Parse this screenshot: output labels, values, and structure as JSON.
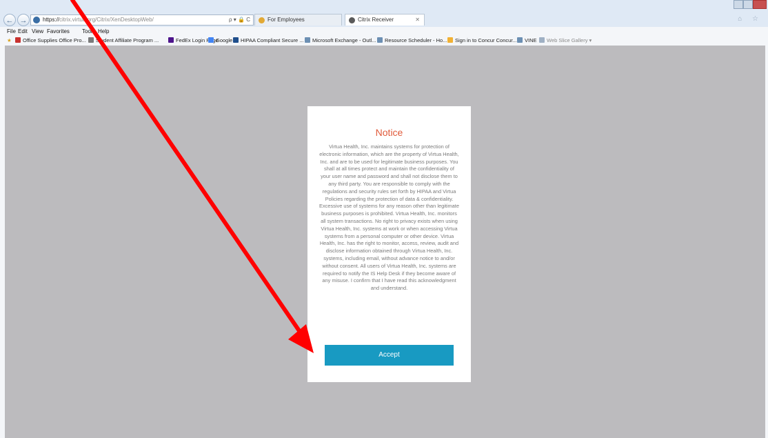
{
  "browser": {
    "address_secure": "https://",
    "address_rest": "citrix.virtua.org/Citrix/XenDesktopWeb/",
    "address_tools": "ρ ▾ 🔒 C",
    "tabs": [
      {
        "label": "For Employees"
      },
      {
        "label": "Citrix Receiver",
        "close": "✕"
      }
    ],
    "nav_back": "←",
    "nav_forward": "→",
    "right_icons": "⌂ ☆"
  },
  "menu": {
    "items": [
      "File",
      "Edit",
      "View",
      "Favorites",
      "Tools",
      "Help"
    ]
  },
  "favorites": {
    "items": [
      {
        "label": "Office Supplies Office Pro..."
      },
      {
        "label": "Student Affiliate Program ..."
      },
      {
        "label": "FedEx Login Page"
      },
      {
        "label": "Google"
      },
      {
        "label": "HIPAA Compliant Secure ..."
      },
      {
        "label": "Microsoft Exchange - Outl..."
      },
      {
        "label": "Resource Scheduler - Ho..."
      },
      {
        "label": "Sign in to Concur Concur..."
      },
      {
        "label": "VINE"
      },
      {
        "label": "Web Slice Gallery ▾"
      }
    ]
  },
  "notice": {
    "title": "Notice",
    "body": "Virtua Health, Inc. maintains systems for protection of electronic information, which are the property of Virtua Health, Inc. and are to be used for legitimate business purposes. You shall at all times protect and maintain the confidentiality of your user name and password and shall not disclose them to any third party. You are responsible to comply with the regulations and security rules set forth by HIPAA and Virtua Policies regarding the protection of data & confidentiality. Excessive use of systems for any reason other than legitimate business purposes is prohibited. Virtua Health, Inc. monitors all system transactions. No right to privacy exists when using Virtua Health, Inc. systems at work or when accessing Virtua systems from a personal computer or other device. Virtua Health, Inc. has the right to monitor, access, review, audit and disclose information obtained through Virtua Health, Inc. systems, including email, without advance notice to and/or without consent. All users of Virtua Health, Inc. systems are required to notify the IS Help Desk if they become aware of any misuse. I confirm that I have read this acknowledgment and understand.",
    "accept_label": "Accept"
  },
  "colors": {
    "page_background": "#bcbbbe",
    "notice_title": "#e05a3a",
    "accept_button": "#189ac2",
    "annotation_arrow": "#ff0000"
  }
}
